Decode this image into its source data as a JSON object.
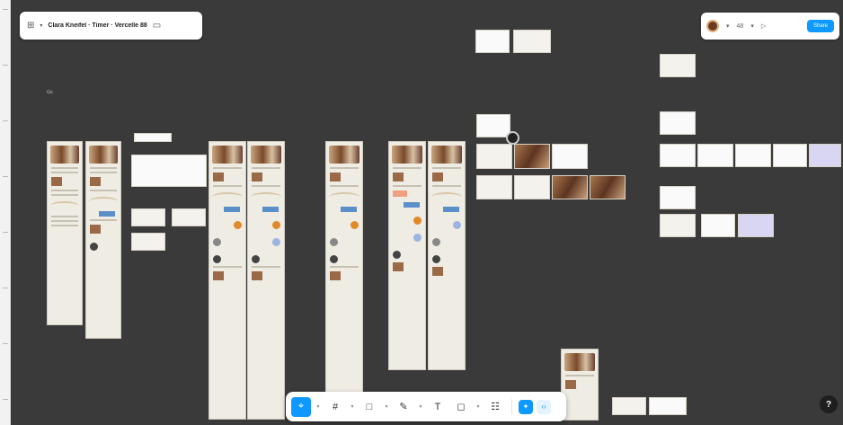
{
  "file": {
    "title": "Clara Kneifel · Timer · Vercelle 88"
  },
  "header": {
    "menu_icon": "figma-menu-icon",
    "sidebar_icon": "sidebar-icon"
  },
  "right_bar": {
    "zoom": "48",
    "share_label": "Share"
  },
  "canvas": {
    "label": "Go"
  },
  "toolbar": {
    "tools": [
      {
        "name": "move-tool",
        "glyph": "⌖"
      },
      {
        "name": "frame-tool",
        "glyph": "#"
      },
      {
        "name": "shape-tool",
        "glyph": "□"
      },
      {
        "name": "pen-tool",
        "glyph": "✎"
      },
      {
        "name": "text-tool",
        "glyph": "T"
      },
      {
        "name": "comment-tool",
        "glyph": "◻"
      },
      {
        "name": "actions-tool",
        "glyph": "☷"
      }
    ]
  },
  "help": {
    "label": "?"
  },
  "colors": {
    "canvas": "#3a3a3a",
    "accent": "#0d99ff",
    "frame": "#efece4"
  }
}
